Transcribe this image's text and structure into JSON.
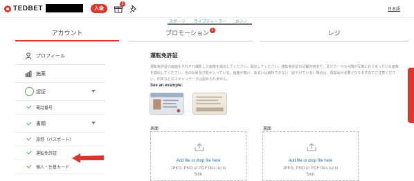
{
  "header": {
    "brand": "TEDBET",
    "deposit_label": "入金",
    "gift_count": "5",
    "language": "日本語"
  },
  "subnav": {
    "items": [
      "スポーツ",
      "ライブディーラー",
      "カジノ"
    ]
  },
  "tabs": {
    "account": "アカウント",
    "promotion": "プロモーション",
    "promotion_badge": "5",
    "cashier": "レジ"
  },
  "sidebar": {
    "profile": "プロフィール",
    "withdrawal": "施薬",
    "verification": "認証",
    "phone": "電話番号",
    "documents": "書類",
    "passport": "旅券（パスポート）",
    "license": "運転免許証",
    "id_card": "個人・住基カード"
  },
  "content": {
    "title": "運転免許証",
    "description": "運転免許証の画面をそれぞれ撮影した画像を提出してください。提出してください。運転免許証の記載内容全て、及びカードの４隅が写真におさまっている画像を提出してください。光の反射及び影が入っている、画面が暗い、あるいは解析できない（ぼやけている）場合は、再提出が必要となりますのでご注意ください。PDFなどのスキャンデータは認められません。",
    "example_label": "See an example:",
    "front_label": "表面",
    "back_label": "裏面",
    "upload_title": "Add file or drop file here",
    "upload_hint_1": "JPEG, PNG or PDF files up to",
    "upload_hint_2": "5mb"
  },
  "colors": {
    "brand": "#e0352b",
    "link": "#1a6fb3",
    "success": "#4caf50",
    "subnav": "#4aa3c7"
  },
  "icons": [
    "user-icon",
    "money-icon",
    "verification-icon",
    "check-icon",
    "chevron-down-icon",
    "gift-icon",
    "pin-icon",
    "upload-icon"
  ]
}
